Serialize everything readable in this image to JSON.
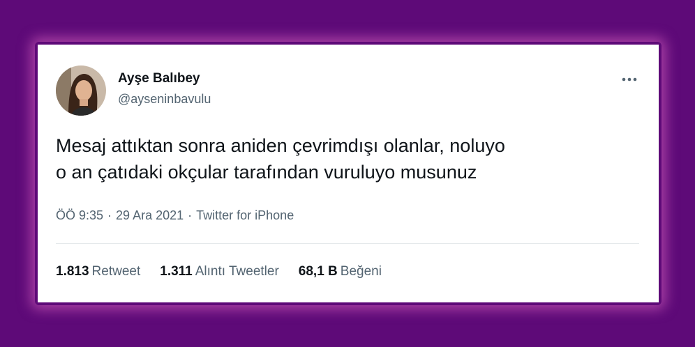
{
  "tweet": {
    "author_name": "Ayşe Balıbey",
    "author_handle": "@ayseninbavulu",
    "text_line1": "Mesaj attıktan sonra aniden çevrimdışı olanlar, noluyo",
    "text_line2": "o an çatıdaki okçular tarafından vuruluyo musunuz",
    "time": "ÖÖ 9:35",
    "date": "29 Ara 2021",
    "source": "Twitter for iPhone",
    "separator": "·"
  },
  "stats": [
    {
      "count": "1.813",
      "label": "Retweet"
    },
    {
      "count": "1.311",
      "label": "Alıntı Tweetler"
    },
    {
      "count": "68,1 B",
      "label": "Beğeni"
    }
  ],
  "colors": {
    "background": "#5e0a78",
    "card": "#ffffff",
    "text_primary": "#0f1419",
    "text_secondary": "#536471",
    "glow": "#e66ec8"
  },
  "icons": {
    "more": "more-horizontal-icon"
  }
}
